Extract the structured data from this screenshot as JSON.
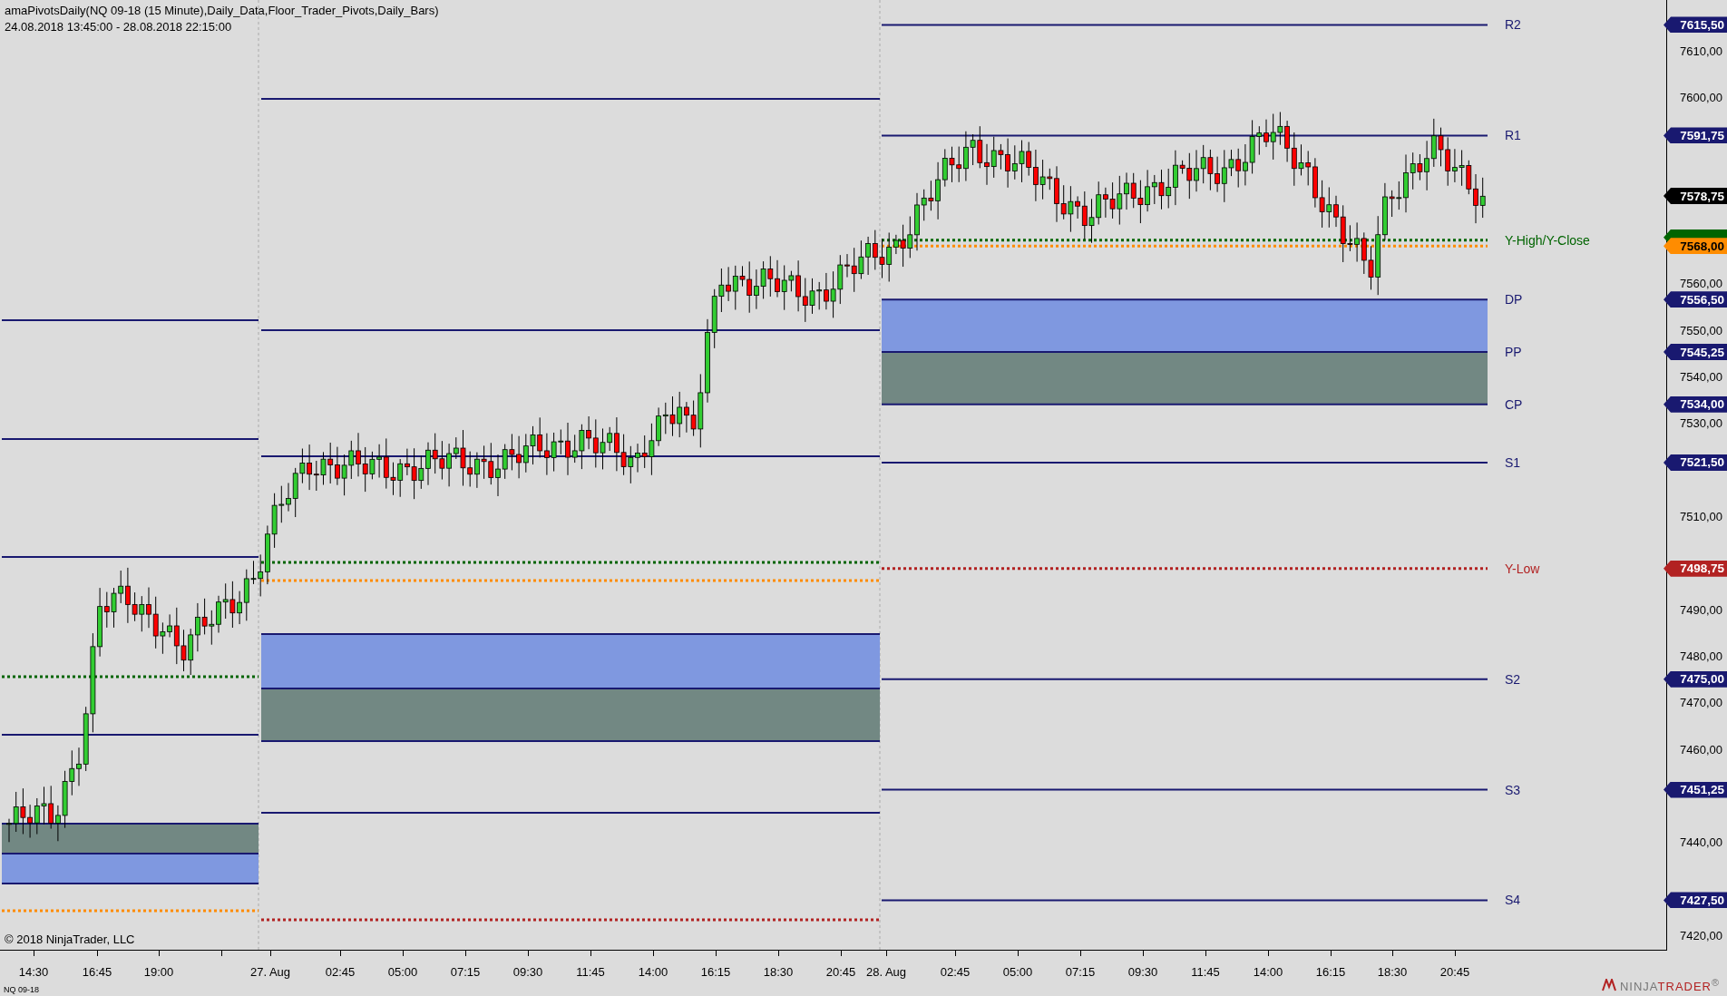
{
  "header": {
    "title": "amaPivotsDaily(NQ 09-18 (15 Minute),Daily_Data,Floor_Trader_Pivots,Daily_Bars)",
    "range": "24.08.2018 13:45:00 - 28.08.2018 22:15:00"
  },
  "levels": [
    {
      "label": "R2",
      "price": "7615,50",
      "color": "#191970",
      "kind": "solid"
    },
    {
      "label": "R1",
      "price": "7591,75",
      "color": "#191970",
      "kind": "solid"
    },
    {
      "label": "Y-High/Y-Close",
      "color": "#006400",
      "kind": "dotted"
    },
    {
      "price": "7568,00",
      "color": "#ff8c00",
      "kind": "dotted"
    },
    {
      "label": "DP",
      "price": "7556,50",
      "color": "#191970",
      "kind": "band-top"
    },
    {
      "label": "PP",
      "price": "7545,25",
      "color": "#191970",
      "kind": "band-mid"
    },
    {
      "label": "CP",
      "price": "7534,00",
      "color": "#191970",
      "kind": "band-bottom"
    },
    {
      "label": "S1",
      "price": "7521,50",
      "color": "#191970",
      "kind": "solid"
    },
    {
      "label": "Y-Low",
      "price": "7498,75",
      "color": "#b22222",
      "kind": "dotted"
    },
    {
      "label": "S2",
      "price": "7475,00",
      "color": "#191970",
      "kind": "solid"
    },
    {
      "label": "S3",
      "price": "7451,25",
      "color": "#191970",
      "kind": "solid"
    },
    {
      "label": "S4",
      "price": "7427,50",
      "color": "#191970",
      "kind": "solid"
    }
  ],
  "last_price": "7578,75",
  "y_ticks": [
    "7610,00",
    "7600,00",
    "7560,00",
    "7550,00",
    "7540,00",
    "7530,00",
    "7510,00",
    "7490,00",
    "7480,00",
    "7470,00",
    "7460,00",
    "7440,00",
    "7420,00"
  ],
  "x_ticks": [
    "14:30",
    "16:45",
    "19:00",
    "27. Aug",
    "02:45",
    "05:00",
    "07:15",
    "09:30",
    "11:45",
    "14:00",
    "16:15",
    "18:30",
    "20:45",
    "28. Aug",
    "02:45",
    "05:00",
    "07:15",
    "09:30",
    "11:45",
    "14:00",
    "16:15",
    "18:30",
    "20:45"
  ],
  "copyright": "© 2018 NinjaTrader, LLC",
  "instrument": "NQ 09-18",
  "logo": {
    "first": "NINJA",
    "second": "TRADER",
    "mark": "®"
  }
}
